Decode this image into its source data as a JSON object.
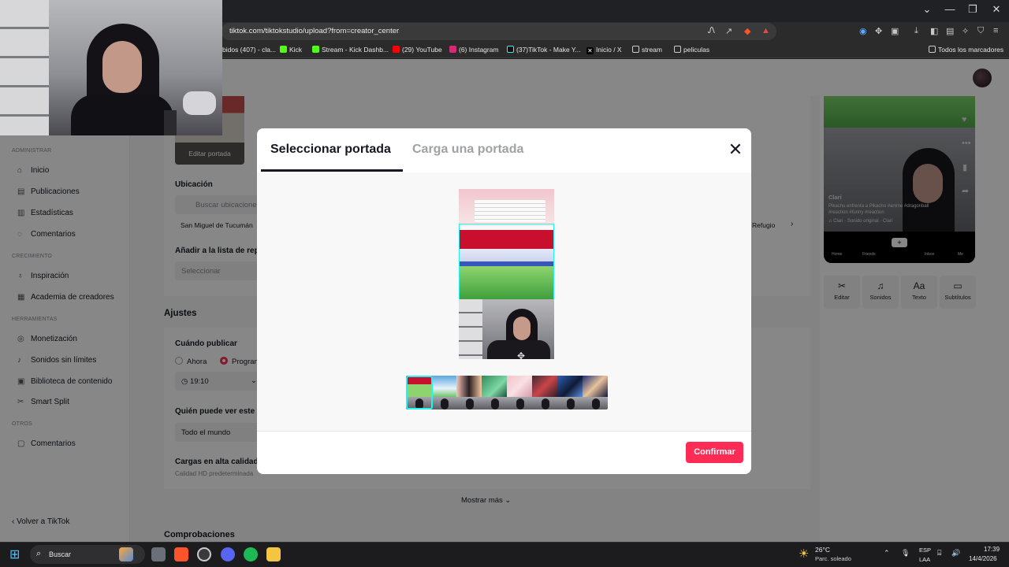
{
  "browser": {
    "url": "tiktok.com/tiktokstudio/upload?from=creator_center",
    "bookmarks": [
      "bidos (407) - cla...",
      "Kick",
      "Stream - Kick Dashb...",
      "(29) YouTube",
      "(6) Instagram",
      "(37)TikTok - Make Y...",
      "Inicio / X",
      "stream",
      "peliculas"
    ],
    "all_bookmarks": "Todos los marcadores"
  },
  "sidebar": {
    "section_admin": "ADMINISTRAR",
    "section_growth": "CRECIMIENTO",
    "section_tools": "HERRAMIENTAS",
    "section_other": "OTROS",
    "items": [
      "Inicio",
      "Publicaciones",
      "Estadísticas",
      "Comentarios",
      "Inspiración",
      "Academia de creadores",
      "Monetización",
      "Sonidos sin límites",
      "Biblioteca de contenido",
      "Smart Split",
      "Comentarios"
    ],
    "back": "Volver a TikTok"
  },
  "upload": {
    "edit_cover": "Editar portada",
    "location_label": "Ubicación",
    "location_placeholder": "Buscar ubicaciones",
    "location_suggestion": "San Miguel de Tucumán",
    "location_suggestion_right": "Refugio",
    "playlist_label": "Añadir a la lista de repro",
    "playlist_placeholder": "Seleccionar",
    "settings_title": "Ajustes",
    "when_label": "Cuándo publicar",
    "now_option": "Ahora",
    "schedule_option": "Program",
    "time_value": "19:10",
    "who_label": "Quién puede ver este vi",
    "who_value": "Todo el mundo",
    "hq_label": "Cargas en alta calidad",
    "hq_desc": "Calidad HD predeterminada",
    "show_more": "Mostrar más",
    "checks_title": "Comprobaciones"
  },
  "preview": {
    "username": "Clari",
    "caption": "Pikachu enfrenta a Pikachu #anime #dragonball #reaction #funny #reaction",
    "sound": "♫ Clari · Sonido original · Clari",
    "nav": [
      "Home",
      "Friends",
      "+",
      "Inbox",
      "Me"
    ],
    "tools": [
      "Editar",
      "Sonidos",
      "Texto",
      "Subtítulos"
    ]
  },
  "modal": {
    "tab_select": "Seleccionar portada",
    "tab_upload": "Carga una portada",
    "confirm": "Confirmar"
  },
  "taskbar": {
    "search": "Buscar",
    "weather_temp": "26°C",
    "weather_desc": "Parc. soleado",
    "lang_top": "ESP",
    "lang_bottom": "LAA",
    "time": "17:39",
    "date": "14/4/2026"
  },
  "colors": {
    "accent": "#fe2c55",
    "selection": "#25f4ee",
    "text": "#161823"
  }
}
